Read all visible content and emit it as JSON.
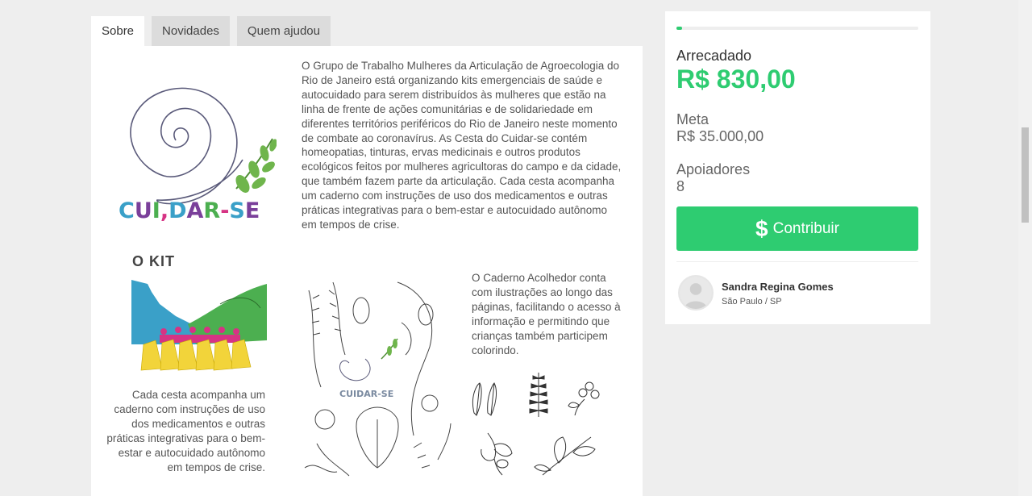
{
  "tabs": [
    {
      "label": "Sobre",
      "active": true
    },
    {
      "label": "Novidades",
      "active": false
    },
    {
      "label": "Quem ajudou",
      "active": false
    }
  ],
  "content": {
    "logo_text": "CUI,DAR-SE",
    "kit_title": "O KIT",
    "intro": "O Grupo de Trabalho Mulheres da Articulação de Agroecologia do Rio de Janeiro está organizando kits emergenciais de saúde e autocuidado para serem distribuídos às mulheres que estão na linha de frente de ações comunitárias e de solidariedade em diferentes territórios periféricos do Rio de Janeiro neste momento de combate ao coronavírus. As Cesta do Cuidar-se contém homeopatias, tinturas, ervas medicinais e outros produtos ecológicos feitos por mulheres agricultoras do campo e da cidade, que também fazem parte da articulação. Cada cesta acompanha um caderno com instruções de uso dos medicamentos e outras práticas integrativas para o bem-estar e autocuidado autônomo em tempos de crise.",
    "kit_caption": "Cada cesta acompanha um caderno com instruções de uso dos medicamentos e outras práticas integrativas para o bem-estar e autocuidado autônomo em tempos de crise.",
    "book_logo_text": "CUIDAR-SE",
    "book_text": "O Caderno Acolhedor conta com ilustrações ao longo das páginas, facilitando o acesso à informação e permitindo que crianças também participem colorindo."
  },
  "campaign": {
    "progress_fraction": 0.0237,
    "raised_label": "Arrecadado",
    "raised_value": "R$ 830,00",
    "goal_label": "Meta",
    "goal_value": "R$ 35.000,00",
    "backers_label": "Apoiadores",
    "backers_value": "8",
    "contribute_icon": "$",
    "contribute_label": "Contribuir",
    "owner_name": "Sandra Regina Gomes",
    "owner_location": "São Paulo / SP"
  },
  "colors": {
    "accent": "#2ecc71",
    "logo_blue": "#3aa0c8",
    "logo_purple": "#7a3f9a",
    "logo_green": "#4caf50",
    "logo_pink": "#d63384",
    "logo_yellow": "#f2d43a"
  }
}
